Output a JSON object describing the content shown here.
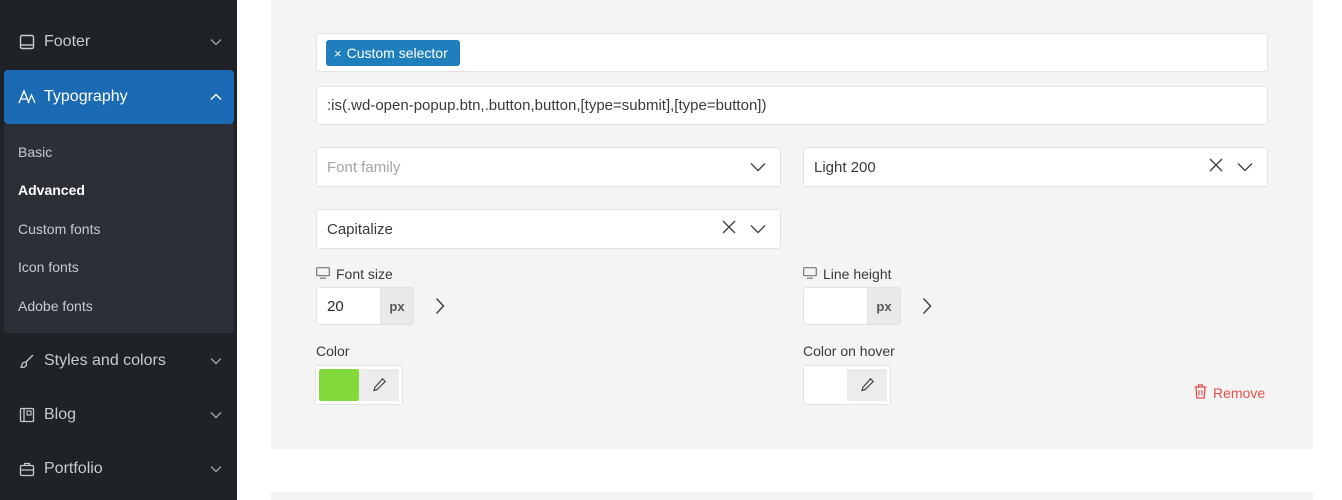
{
  "sidebar": {
    "items": [
      {
        "label": "Footer",
        "icon": "footer-icon"
      },
      {
        "label": "Typography",
        "icon": "typography-icon"
      },
      {
        "label": "Styles and colors",
        "icon": "brush-icon"
      },
      {
        "label": "Blog",
        "icon": "blog-icon"
      },
      {
        "label": "Portfolio",
        "icon": "briefcase-icon"
      }
    ],
    "submenu": [
      "Basic",
      "Advanced",
      "Custom fonts",
      "Icon fonts",
      "Adobe fonts"
    ],
    "active_item": "Typography",
    "current_subitem": "Advanced"
  },
  "main": {
    "selector_tag": "Custom selector",
    "custom_selector_value": ":is(.wd-open-popup.btn,.button,button,[type=submit],[type=button])",
    "font_family": {
      "placeholder": "Font family"
    },
    "font_weight": {
      "value": "Light 200"
    },
    "text_transform": {
      "value": "Capitalize"
    },
    "font_size": {
      "label": "Font size",
      "value": "20",
      "unit": "px"
    },
    "line_height": {
      "label": "Line height",
      "value": "",
      "unit": "px"
    },
    "color": {
      "label": "Color",
      "value": "#84d93c"
    },
    "color_hover": {
      "label": "Color on hover",
      "value": ""
    },
    "remove_label": "Remove"
  },
  "colors": {
    "accent": "#1a6bb3",
    "tag": "#1f7fbd",
    "remove": "#e0514a"
  }
}
